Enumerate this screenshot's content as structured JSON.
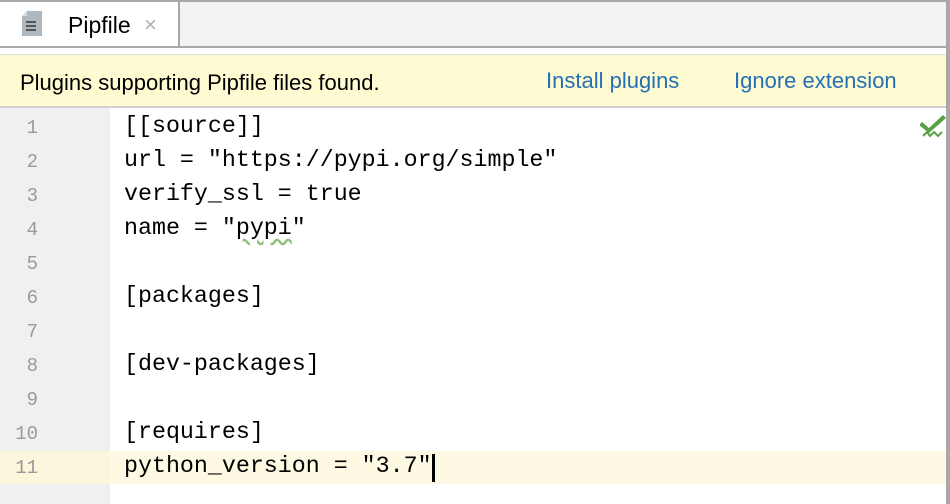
{
  "tab": {
    "name": "Pipfile",
    "close": "×"
  },
  "notification": {
    "message": "Plugins supporting Pipfile files found.",
    "install": "Install plugins",
    "ignore": "Ignore extension"
  },
  "editor": {
    "lines": [
      {
        "n": "1",
        "parts": [
          {
            "t": "[[source]]"
          }
        ]
      },
      {
        "n": "2",
        "parts": [
          {
            "t": "url = \"https://pypi.org/simple\""
          }
        ]
      },
      {
        "n": "3",
        "parts": [
          {
            "t": "verify_ssl = true"
          }
        ]
      },
      {
        "n": "4",
        "parts": [
          {
            "t": "name = \""
          },
          {
            "t": "pypi",
            "squig": true
          },
          {
            "t": "\""
          }
        ]
      },
      {
        "n": "5",
        "parts": [
          {
            "t": ""
          }
        ]
      },
      {
        "n": "6",
        "parts": [
          {
            "t": "[packages]"
          }
        ]
      },
      {
        "n": "7",
        "parts": [
          {
            "t": ""
          }
        ]
      },
      {
        "n": "8",
        "parts": [
          {
            "t": "[dev-packages]"
          }
        ]
      },
      {
        "n": "9",
        "parts": [
          {
            "t": ""
          }
        ]
      },
      {
        "n": "10",
        "parts": [
          {
            "t": "[requires]"
          }
        ]
      },
      {
        "n": "11",
        "parts": [
          {
            "t": "python_version = \"3.7\""
          }
        ]
      }
    ],
    "current_line": 11,
    "status_icon": "inspection-ok-icon"
  }
}
